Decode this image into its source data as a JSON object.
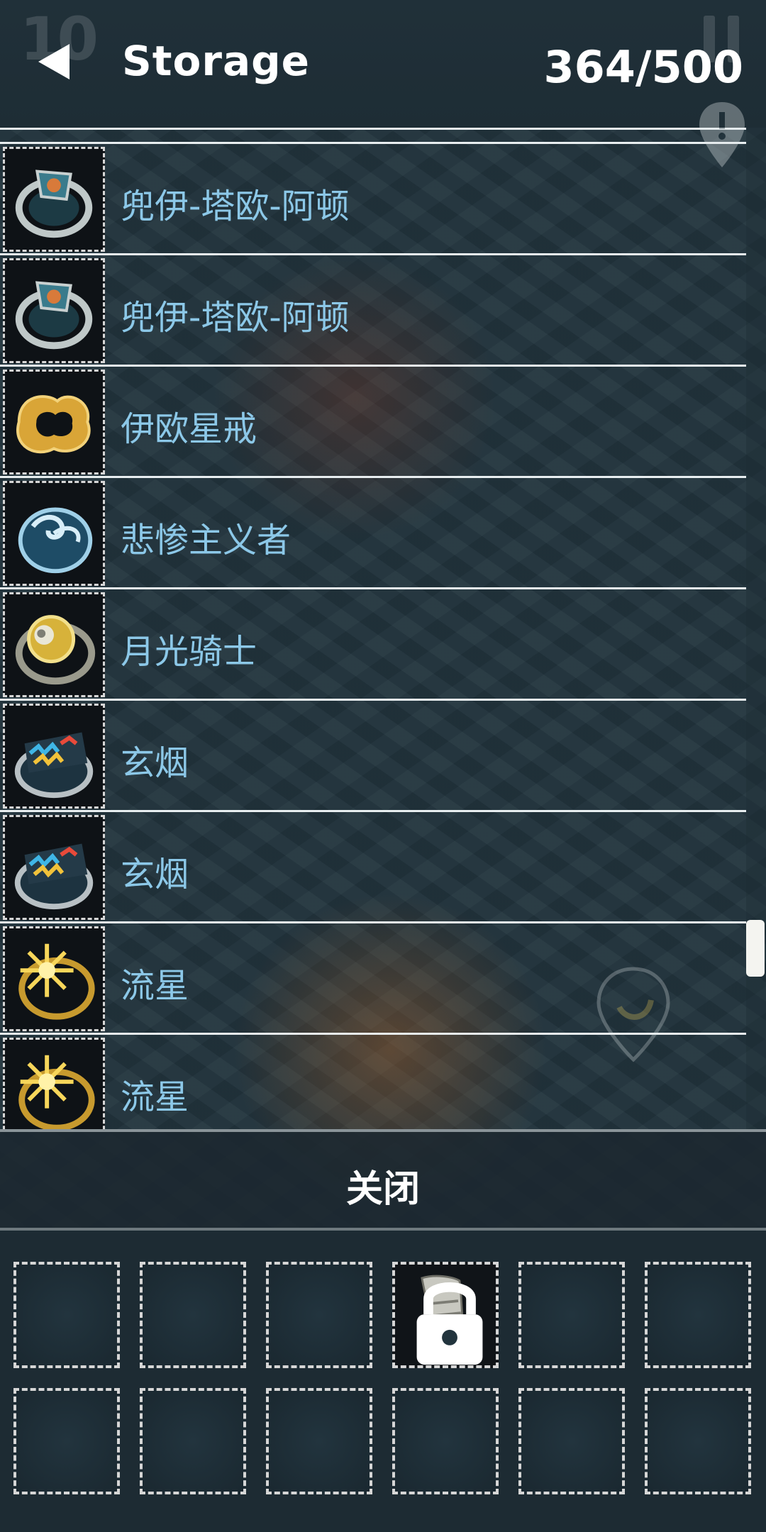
{
  "header": {
    "title": "Storage",
    "capacity": "364/500",
    "back_icon": "back-arrow-icon",
    "level_watermark": "10"
  },
  "storage_items": [
    {
      "label": "兜伊-塔欧-阿顿",
      "icon": "ring-blue-gem-icon"
    },
    {
      "label": "兜伊-塔欧-阿顿",
      "icon": "ring-blue-gem-icon"
    },
    {
      "label": "伊欧星戒",
      "icon": "ring-gold-star-icon"
    },
    {
      "label": "悲惨主义者",
      "icon": "ring-blue-swirl-icon"
    },
    {
      "label": "月光骑士",
      "icon": "ring-gold-moon-icon"
    },
    {
      "label": "玄烟",
      "icon": "ring-rainbow-icon"
    },
    {
      "label": "玄烟",
      "icon": "ring-rainbow-icon"
    },
    {
      "label": "流星",
      "icon": "ring-gold-burst-icon"
    },
    {
      "label": "流星",
      "icon": "ring-gold-burst-icon"
    }
  ],
  "close_button": {
    "label": "关闭"
  },
  "inventory": {
    "rows": 2,
    "columns": 6,
    "filled_slot": {
      "row": 0,
      "col": 3,
      "icon": "boots-icon",
      "locked": true
    }
  },
  "colors": {
    "item_text": "#8cc8e8",
    "divider": "#e8eef0",
    "background": "#22343d"
  }
}
